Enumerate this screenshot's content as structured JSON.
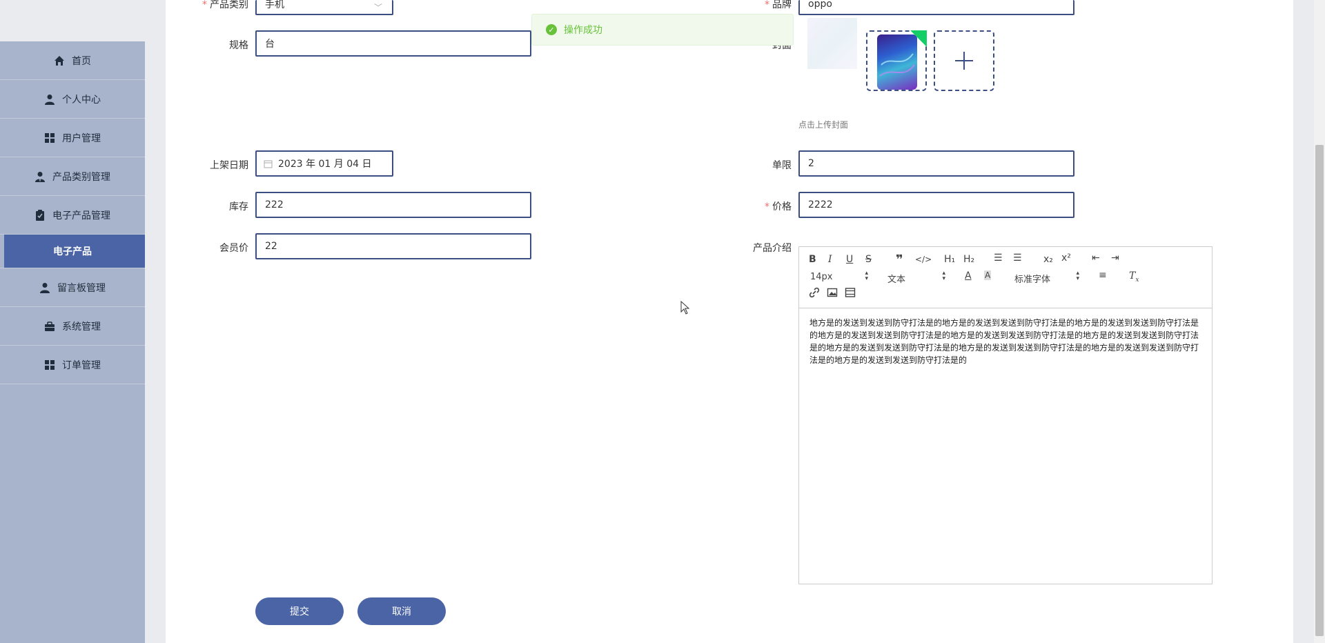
{
  "sidebar": {
    "items": [
      {
        "label": "首页",
        "icon": "home-icon"
      },
      {
        "label": "个人中心",
        "icon": "user-icon"
      },
      {
        "label": "用户管理",
        "icon": "grid-icon"
      },
      {
        "label": "产品类别管理",
        "icon": "user-tie-icon"
      },
      {
        "label": "电子产品管理",
        "icon": "clipboard-icon"
      },
      {
        "label": "电子产品",
        "icon": ""
      },
      {
        "label": "留言板管理",
        "icon": "user-icon"
      },
      {
        "label": "系统管理",
        "icon": "briefcase-icon"
      },
      {
        "label": "订单管理",
        "icon": "grid-icon"
      }
    ]
  },
  "toast": {
    "message": "操作成功"
  },
  "form": {
    "category": {
      "label": "产品类别",
      "value": "手机"
    },
    "brand": {
      "label": "品牌",
      "value": "oppo"
    },
    "spec": {
      "label": "规格",
      "value": "台"
    },
    "cover": {
      "label": "封面",
      "hint": "点击上传封面"
    },
    "date": {
      "label": "上架日期",
      "value": "2023 年 01 月 04 日"
    },
    "limit": {
      "label": "单限",
      "value": "2"
    },
    "stock": {
      "label": "库存",
      "value": "222"
    },
    "price": {
      "label": "价格",
      "value": "2222"
    },
    "member_price": {
      "label": "会员价",
      "value": "22"
    },
    "intro": {
      "label": "产品介绍",
      "toolbar": {
        "font_size": "14px",
        "text_type": "文本",
        "font_family": "标准字体"
      },
      "content": "地方是的发送到发送到防守打法是的地方是的发送到发送到防守打法是的地方是的发送到发送到防守打法是的地方是的发送到发送到防守打法是的地方是的发送到发送到防守打法是的地方是的发送到发送到防守打法是的地方是的发送到发送到防守打法是的地方是的发送到发送到防守打法是的地方是的发送到发送到防守打法是的地方是的发送到发送到防守打法是的"
    },
    "required_mark": "*"
  },
  "buttons": {
    "submit": "提交",
    "cancel": "取消"
  },
  "colors": {
    "primary": "#4a64a6",
    "sidebar": "#a8b4cb",
    "success": "#67c23a"
  }
}
